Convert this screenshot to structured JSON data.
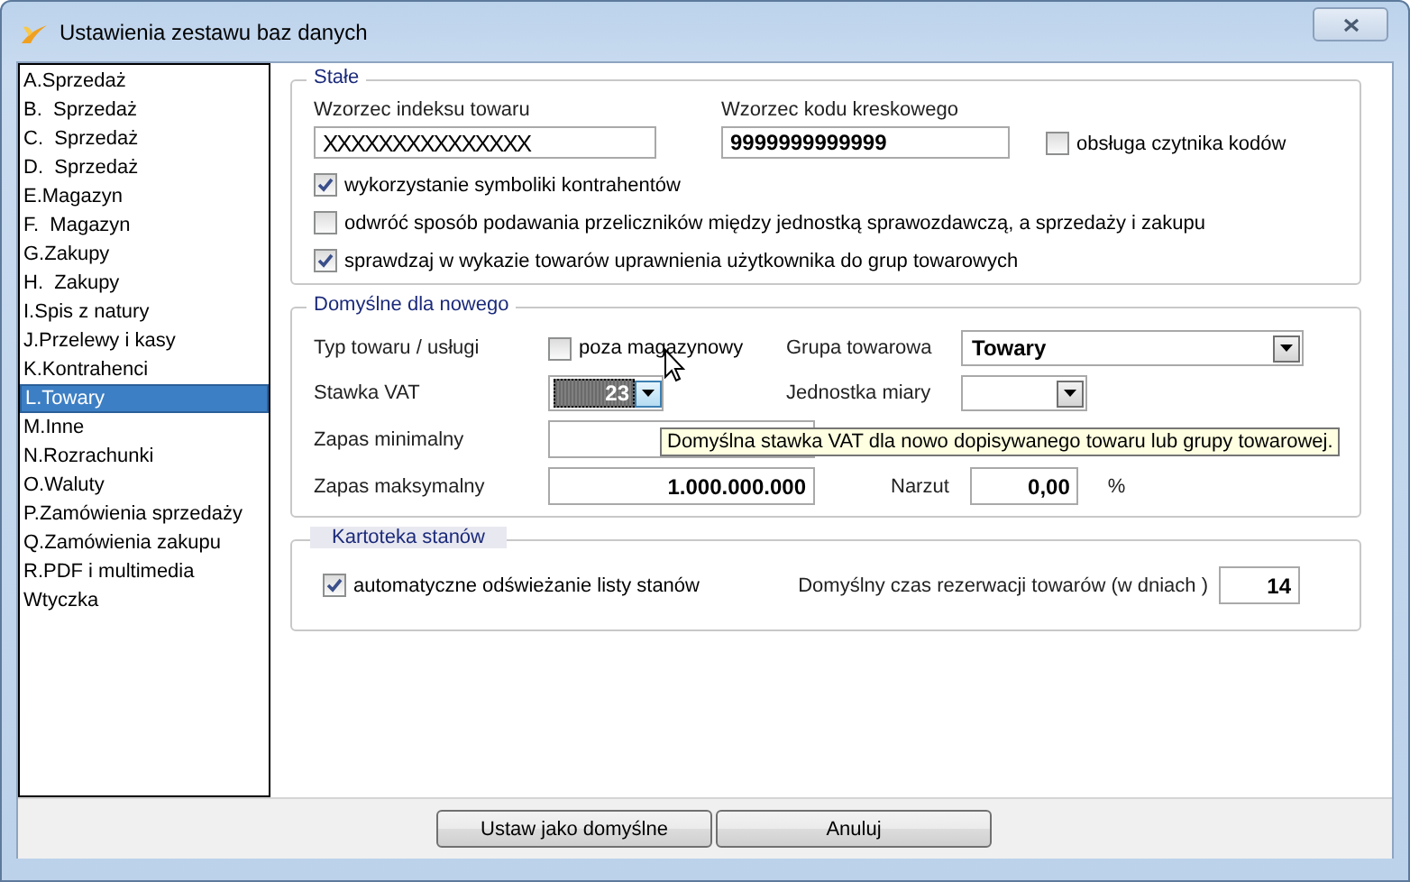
{
  "window": {
    "title": "Ustawienia zestawu baz danych"
  },
  "sidebar": {
    "items": [
      {
        "label": "A.Sprzedaż",
        "selected": false
      },
      {
        "label": "B.  Sprzedaż",
        "selected": false
      },
      {
        "label": "C.  Sprzedaż",
        "selected": false
      },
      {
        "label": "D.  Sprzedaż",
        "selected": false
      },
      {
        "label": "E.Magazyn",
        "selected": false
      },
      {
        "label": "F.  Magazyn",
        "selected": false
      },
      {
        "label": "G.Zakupy",
        "selected": false
      },
      {
        "label": "H.  Zakupy",
        "selected": false
      },
      {
        "label": "I.Spis z natury",
        "selected": false
      },
      {
        "label": "J.Przelewy i kasy",
        "selected": false
      },
      {
        "label": "K.Kontrahenci",
        "selected": false
      },
      {
        "label": "L.Towary",
        "selected": true
      },
      {
        "label": "M.Inne",
        "selected": false
      },
      {
        "label": "N.Rozrachunki",
        "selected": false
      },
      {
        "label": "O.Waluty",
        "selected": false
      },
      {
        "label": "P.Zamówienia sprzedaży",
        "selected": false
      },
      {
        "label": "Q.Zamówienia zakupu",
        "selected": false
      },
      {
        "label": "R.PDF i multimedia",
        "selected": false
      },
      {
        "label": "Wtyczka",
        "selected": false
      }
    ]
  },
  "fixed": {
    "title": "Stałe",
    "index_pattern": {
      "label": "Wzorzec indeksu towaru",
      "value": "XXXXXXXXXXXXXXX"
    },
    "barcode_pattern": {
      "label": "Wzorzec kodu kreskowego",
      "value": "9999999999999"
    },
    "reader": {
      "label": "obsługa czytnika kodów",
      "checked": false
    },
    "options": [
      {
        "label": "wykorzystanie symboliki kontrahentów",
        "checked": true
      },
      {
        "label": "odwróć sposób podawania przeliczników między jednostką sprawozdawczą, a sprzedaży i zakupu",
        "checked": false
      },
      {
        "label": "sprawdzaj w wykazie towarów uprawnienia użytkownika do grup towarowych",
        "checked": true
      }
    ]
  },
  "defaults": {
    "title": "Domyślne dla nowego",
    "type_label": "Typ towaru / usługi",
    "non_stock": {
      "label": "poza magazynowy",
      "checked": false
    },
    "group_label": "Grupa towarowa",
    "group_value": "Towary",
    "vat_label": "Stawka VAT",
    "vat_value": "23",
    "unit_label": "Jednostka miary",
    "min_label": "Zapas minimalny",
    "max_label": "Zapas maksymalny",
    "max_value": "1.000.000.000",
    "markup_label": "Narzut",
    "markup_value": "0,00",
    "markup_unit": "%"
  },
  "stock_card": {
    "title": "Kartoteka stanów",
    "auto_refresh": {
      "label": "automatyczne odświeżanie listy stanów",
      "checked": true
    },
    "reservation_label": "Domyślny czas rezerwacji towarów (w dniach )",
    "reservation_value": "14"
  },
  "tooltip": "Domyślna stawka VAT dla nowo dopisywanego towaru lub grupy towarowej.",
  "buttons": [
    {
      "label": "Ustaw jako domyślne"
    },
    {
      "label": "Anuluj"
    }
  ]
}
